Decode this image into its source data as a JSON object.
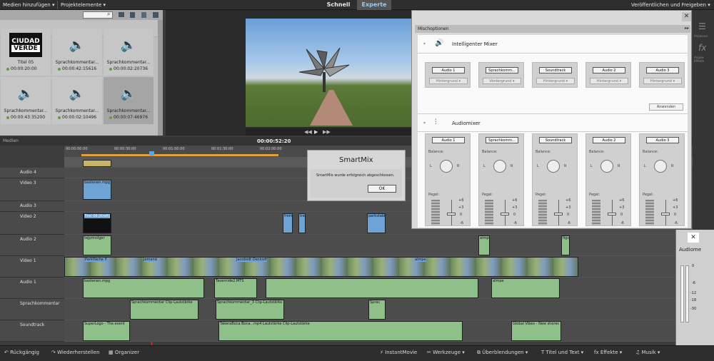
{
  "menu": {
    "add_media": "Medien hinzufügen",
    "project_assets": "Projektelemente",
    "mode_quick": "Schnell",
    "mode_expert": "Experte",
    "publish": "Veröffentlichen und Freigeben"
  },
  "media": {
    "items": [
      {
        "name": "Titel 05",
        "time": "00:00:20:00",
        "type": "title",
        "logo_line1": "CIUDAD",
        "logo_line2": "VERDE"
      },
      {
        "name": "Sprachkommentar...",
        "time": "00:00:42:15616",
        "type": "audio"
      },
      {
        "name": "Sprachkommentar...",
        "time": "00:00:02:20736",
        "type": "audio"
      },
      {
        "name": "Sprachkommentar...",
        "time": "00:00:43:35200",
        "type": "audio"
      },
      {
        "name": "Sprachkommentar...",
        "time": "00:00:02:10496",
        "type": "audio"
      },
      {
        "name": "Sprachkommentar...",
        "time": "00:00:07:46976",
        "type": "audio",
        "selected": true
      }
    ]
  },
  "monitor": {
    "timecode": "00:00:52:20"
  },
  "timeline": {
    "header": "Medien",
    "ruler": [
      "00:00:00:00",
      "00:00:30:00",
      "00:01:00:00",
      "00:01:30:00",
      "00:02:00:00"
    ],
    "tracks": [
      {
        "name": "Audio 4",
        "kind": "audio"
      },
      {
        "name": "Video 3",
        "kind": "video"
      },
      {
        "name": "Audio 3",
        "kind": "audio"
      },
      {
        "name": "Video 2",
        "kind": "video"
      },
      {
        "name": "Audio 2",
        "kind": "audio"
      },
      {
        "name": "Video 1",
        "kind": "video"
      },
      {
        "name": "Audio 1",
        "kind": "audio"
      },
      {
        "name": "Sprachkommentar",
        "kind": "mic"
      },
      {
        "name": "Soundtrack",
        "kind": "music"
      }
    ],
    "clips": {
      "v3": "bastenen.mpg",
      "v2a": "Titel 06 [Kraft]",
      "v2b": "from",
      "v2c": "tre",
      "v2d": "parkstabil",
      "a2a": "tejpmvilger",
      "a2b": "almpe",
      "a2c": "figs",
      "v1a": "Parkfläche fl",
      "v1b": "Jemand",
      "v1c": "Jacobsdt Decksdt",
      "v1d": "almpe",
      "a1a": "bastenen.mpg",
      "a1b": "Tavernide2.MTS",
      "a1c": "almpe",
      "sk1": "Sprachkommentar Clip-Lautstärke",
      "sk2": "Sprachkommentar_3 Clip-Lautstärke",
      "sk3": "Sprac",
      "st1": "SuperLogo - The event",
      "st2": "TakeraBoca Boca...mp4 Lautstärke Clip-Lautstärke",
      "st3": "Global Vibes - New shores"
    }
  },
  "smartmix": {
    "title": "SmartMix",
    "message": "SmartMix wurde erfolgreich abgeschlossen.",
    "ok": "OK"
  },
  "mixoptions": {
    "title": "Mischoptionen",
    "smart_mixer": "Intelligenter Mixer",
    "audio_mixer": "Audiomixer",
    "apply": "Anwenden",
    "balance": "Balance:",
    "level": "Pegel:",
    "scale": [
      "+6",
      "+3",
      "0",
      "-6"
    ],
    "channels": [
      {
        "name": "Audio 1",
        "mode": "Hintergrund"
      },
      {
        "name": "Sprachkomm...",
        "mode": "Vordergrund"
      },
      {
        "name": "Soundtrack",
        "mode": "Hintergrund"
      },
      {
        "name": "Audio 2",
        "mode": "Hintergrund"
      },
      {
        "name": "Audio 3",
        "mode": "Hintergrund"
      }
    ]
  },
  "rightpanel": {
    "title": "Audiome",
    "scale": [
      "0",
      "-6",
      "-12",
      "-18",
      "-30"
    ],
    "adjust": "Anpassen",
    "fx": "fx",
    "effects": "Angew. Effekte"
  },
  "bottom": {
    "undo": "Rückgängig",
    "redo": "Wiederherstellen",
    "organizer": "Organizer",
    "instantmovie": "InstantMovie",
    "tools": "Werkzeuge",
    "transitions": "Überblendungen",
    "titles": "Titel und Text",
    "effects": "Effekte",
    "music": "Musik"
  }
}
